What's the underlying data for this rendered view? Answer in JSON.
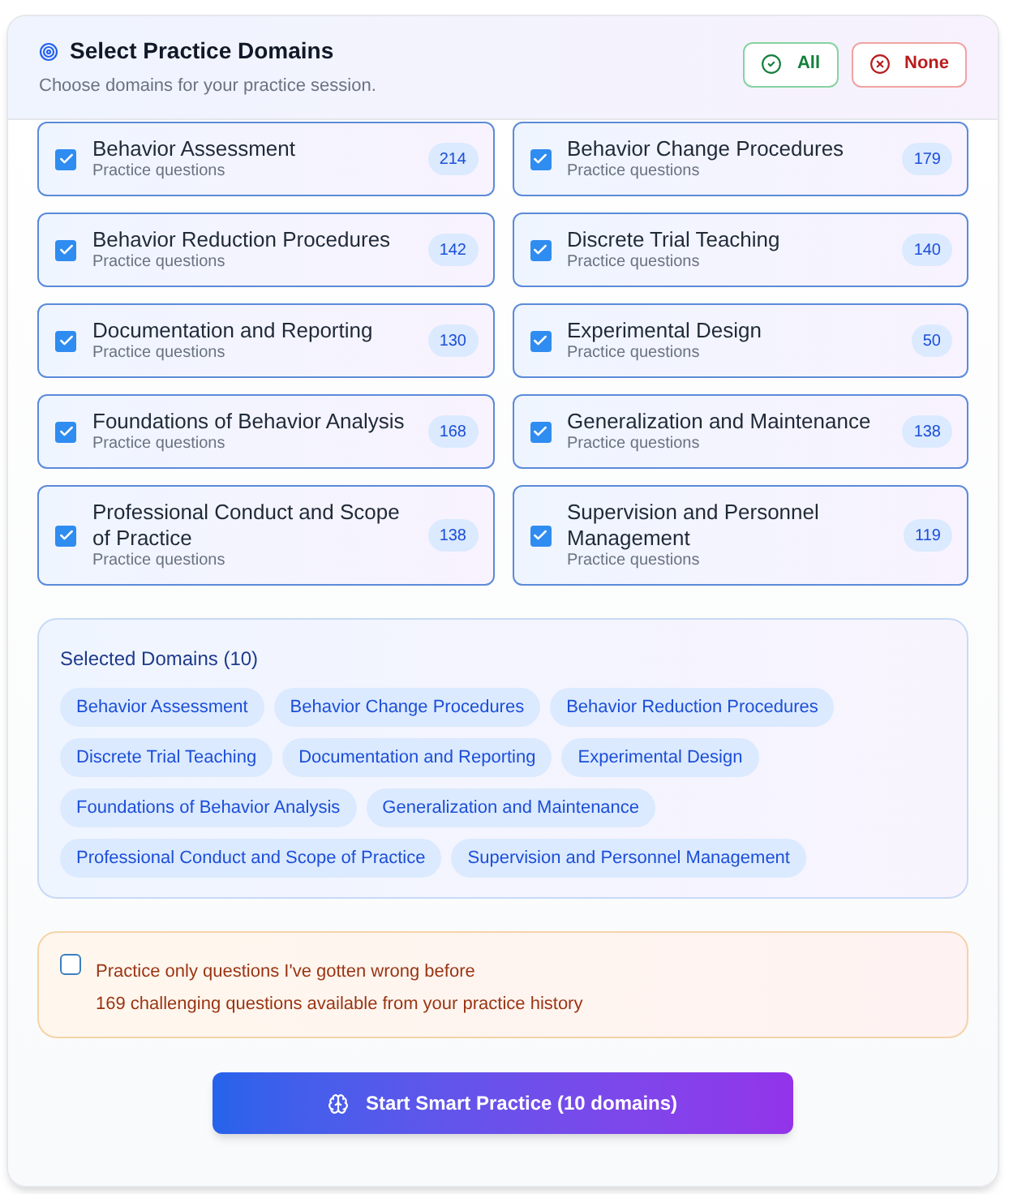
{
  "header": {
    "title": "Select Practice Domains",
    "subtitle": "Choose domains for your practice session.",
    "buttons": [
      {
        "kind": "all",
        "label": "All"
      },
      {
        "kind": "none",
        "label": "None"
      }
    ]
  },
  "domains": [
    {
      "name": "Behavior Assessment",
      "subtitle": "Practice questions",
      "count": "214",
      "checked": true
    },
    {
      "name": "Behavior Change Procedures",
      "subtitle": "Practice questions",
      "count": "179",
      "checked": true
    },
    {
      "name": "Behavior Reduction Procedures",
      "subtitle": "Practice questions",
      "count": "142",
      "checked": true
    },
    {
      "name": "Discrete Trial Teaching",
      "subtitle": "Practice questions",
      "count": "140",
      "checked": true
    },
    {
      "name": "Documentation and Reporting",
      "subtitle": "Practice questions",
      "count": "130",
      "checked": true
    },
    {
      "name": "Experimental Design",
      "subtitle": "Practice questions",
      "count": "50",
      "checked": true
    },
    {
      "name": "Foundations of Behavior Analysis",
      "subtitle": "Practice questions",
      "count": "168",
      "checked": true
    },
    {
      "name": "Generalization and Maintenance",
      "subtitle": "Practice questions",
      "count": "138",
      "checked": true
    },
    {
      "name": "Professional Conduct and Scope of Practice",
      "subtitle": "Practice questions",
      "count": "138",
      "checked": true
    },
    {
      "name": "Supervision and Personnel Management",
      "subtitle": "Practice questions",
      "count": "119",
      "checked": true
    }
  ],
  "selected_panel": {
    "title": "Selected Domains (10)",
    "chips": [
      "Behavior Assessment",
      "Behavior Change Procedures",
      "Behavior Reduction Procedures",
      "Discrete Trial Teaching",
      "Documentation and Reporting",
      "Experimental Design",
      "Foundations of Behavior Analysis",
      "Generalization and Maintenance",
      "Professional Conduct and Scope of Practice",
      "Supervision and Personnel Management"
    ]
  },
  "wrong_only": {
    "checked": false,
    "label": "Practice only questions I've gotten wrong before",
    "note": "169 challenging questions available from your practice history"
  },
  "start_button": {
    "label": "Start Smart Practice (10 domains)"
  }
}
